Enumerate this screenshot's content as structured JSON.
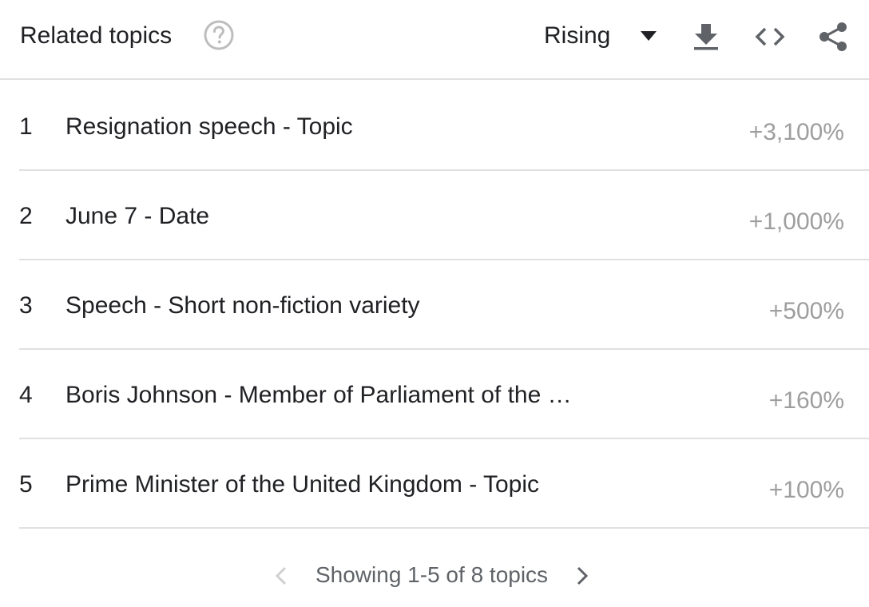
{
  "header": {
    "title": "Related topics",
    "help_icon": "help-circle-icon",
    "filter_selected": "Rising",
    "icons": [
      "download-icon",
      "embed-code-icon",
      "share-icon"
    ]
  },
  "rows": [
    {
      "rank": "1",
      "label": "Resignation speech - Topic",
      "value": "+3,100%"
    },
    {
      "rank": "2",
      "label": "June 7 - Date",
      "value": "+1,000%"
    },
    {
      "rank": "3",
      "label": "Speech - Short non-fiction variety",
      "value": "+500%"
    },
    {
      "rank": "4",
      "label": "Boris Johnson - Member of Parliament of the …",
      "value": "+160%"
    },
    {
      "rank": "5",
      "label": "Prime Minister of the United Kingdom - Topic",
      "value": "+100%"
    }
  ],
  "pager": {
    "text": "Showing 1-5 of 8 topics",
    "prev_icon": "chevron-left-icon",
    "next_icon": "chevron-right-icon"
  },
  "colors": {
    "text": "#202124",
    "muted": "#9e9e9e",
    "icon": "#5f6368",
    "divider": "#e0e0e0",
    "disabled": "#bdbdbd"
  }
}
